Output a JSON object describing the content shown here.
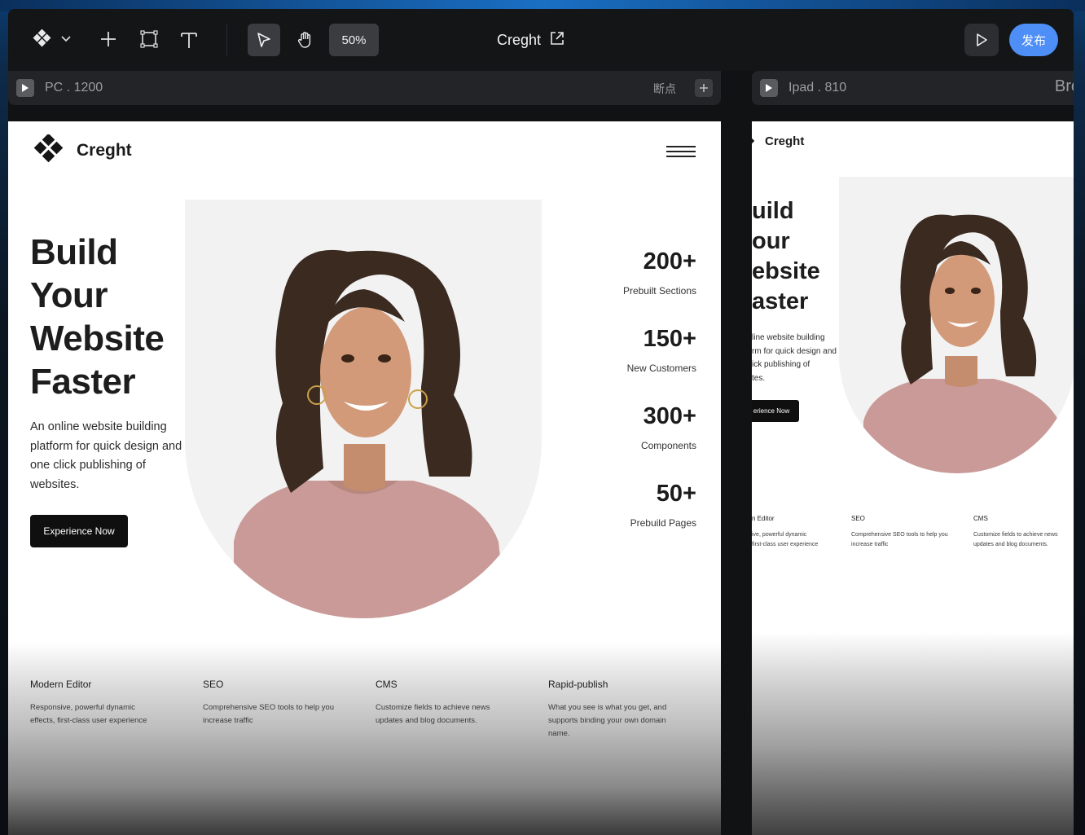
{
  "toolbar": {
    "zoom": "50%",
    "project_title": "Creght",
    "publish_label": "发布"
  },
  "frames": {
    "pc": {
      "label": "PC . 1200",
      "breakpoint_label": "断点"
    },
    "ipad": {
      "label": "Ipad . 810",
      "breakpoint_partial": "Bre"
    }
  },
  "site": {
    "brand": "Creght",
    "hero_title": [
      "Build",
      "Your",
      "Website",
      "Faster"
    ],
    "hero_description": [
      "An online website building",
      "platform for quick design and",
      "one click publishing of",
      "websites."
    ],
    "cta_label": "Experience Now",
    "stats": [
      {
        "value": "200+",
        "label": "Prebuilt Sections"
      },
      {
        "value": "150+",
        "label": "New Customers"
      },
      {
        "value": "300+",
        "label": "Components"
      },
      {
        "value": "50+",
        "label": "Prebuild Pages"
      }
    ],
    "features": [
      {
        "title": "Modern Editor",
        "desc": [
          "Responsive, powerful dynamic",
          "effects, first-class user experience"
        ]
      },
      {
        "title": "SEO",
        "desc": [
          "Comprehensive SEO tools to help you",
          "increase traffic"
        ]
      },
      {
        "title": "CMS",
        "desc": [
          "Customize fields to achieve news",
          "updates and blog documents."
        ]
      },
      {
        "title": "Rapid-publish",
        "desc": [
          "What you see is what you get, and",
          "supports binding your own domain",
          "name."
        ]
      }
    ]
  },
  "ipad_view": {
    "brand": "Creght",
    "hero_title": [
      "uild",
      "our",
      "ebsite",
      "aster"
    ],
    "hero_description": [
      "line website building",
      "rm for quick design and",
      "ick publishing of",
      "tes."
    ],
    "cta_label": "erience Now",
    "features": [
      {
        "title": "n Editor",
        "desc": [
          "ive, powerful dynamic",
          "first-class user experience"
        ]
      },
      {
        "title": "SEO",
        "desc": [
          "Comprehensive SEO tools to help you",
          "increase traffic"
        ]
      },
      {
        "title": "CMS",
        "desc": [
          "Customize fields to achieve news",
          "updates and blog documents."
        ]
      }
    ]
  },
  "colors": {
    "accent": "#4d8ef7",
    "toolbar_bg": "#141517",
    "button_dark": "#0f0f0f",
    "shirt": "#c99a98"
  }
}
